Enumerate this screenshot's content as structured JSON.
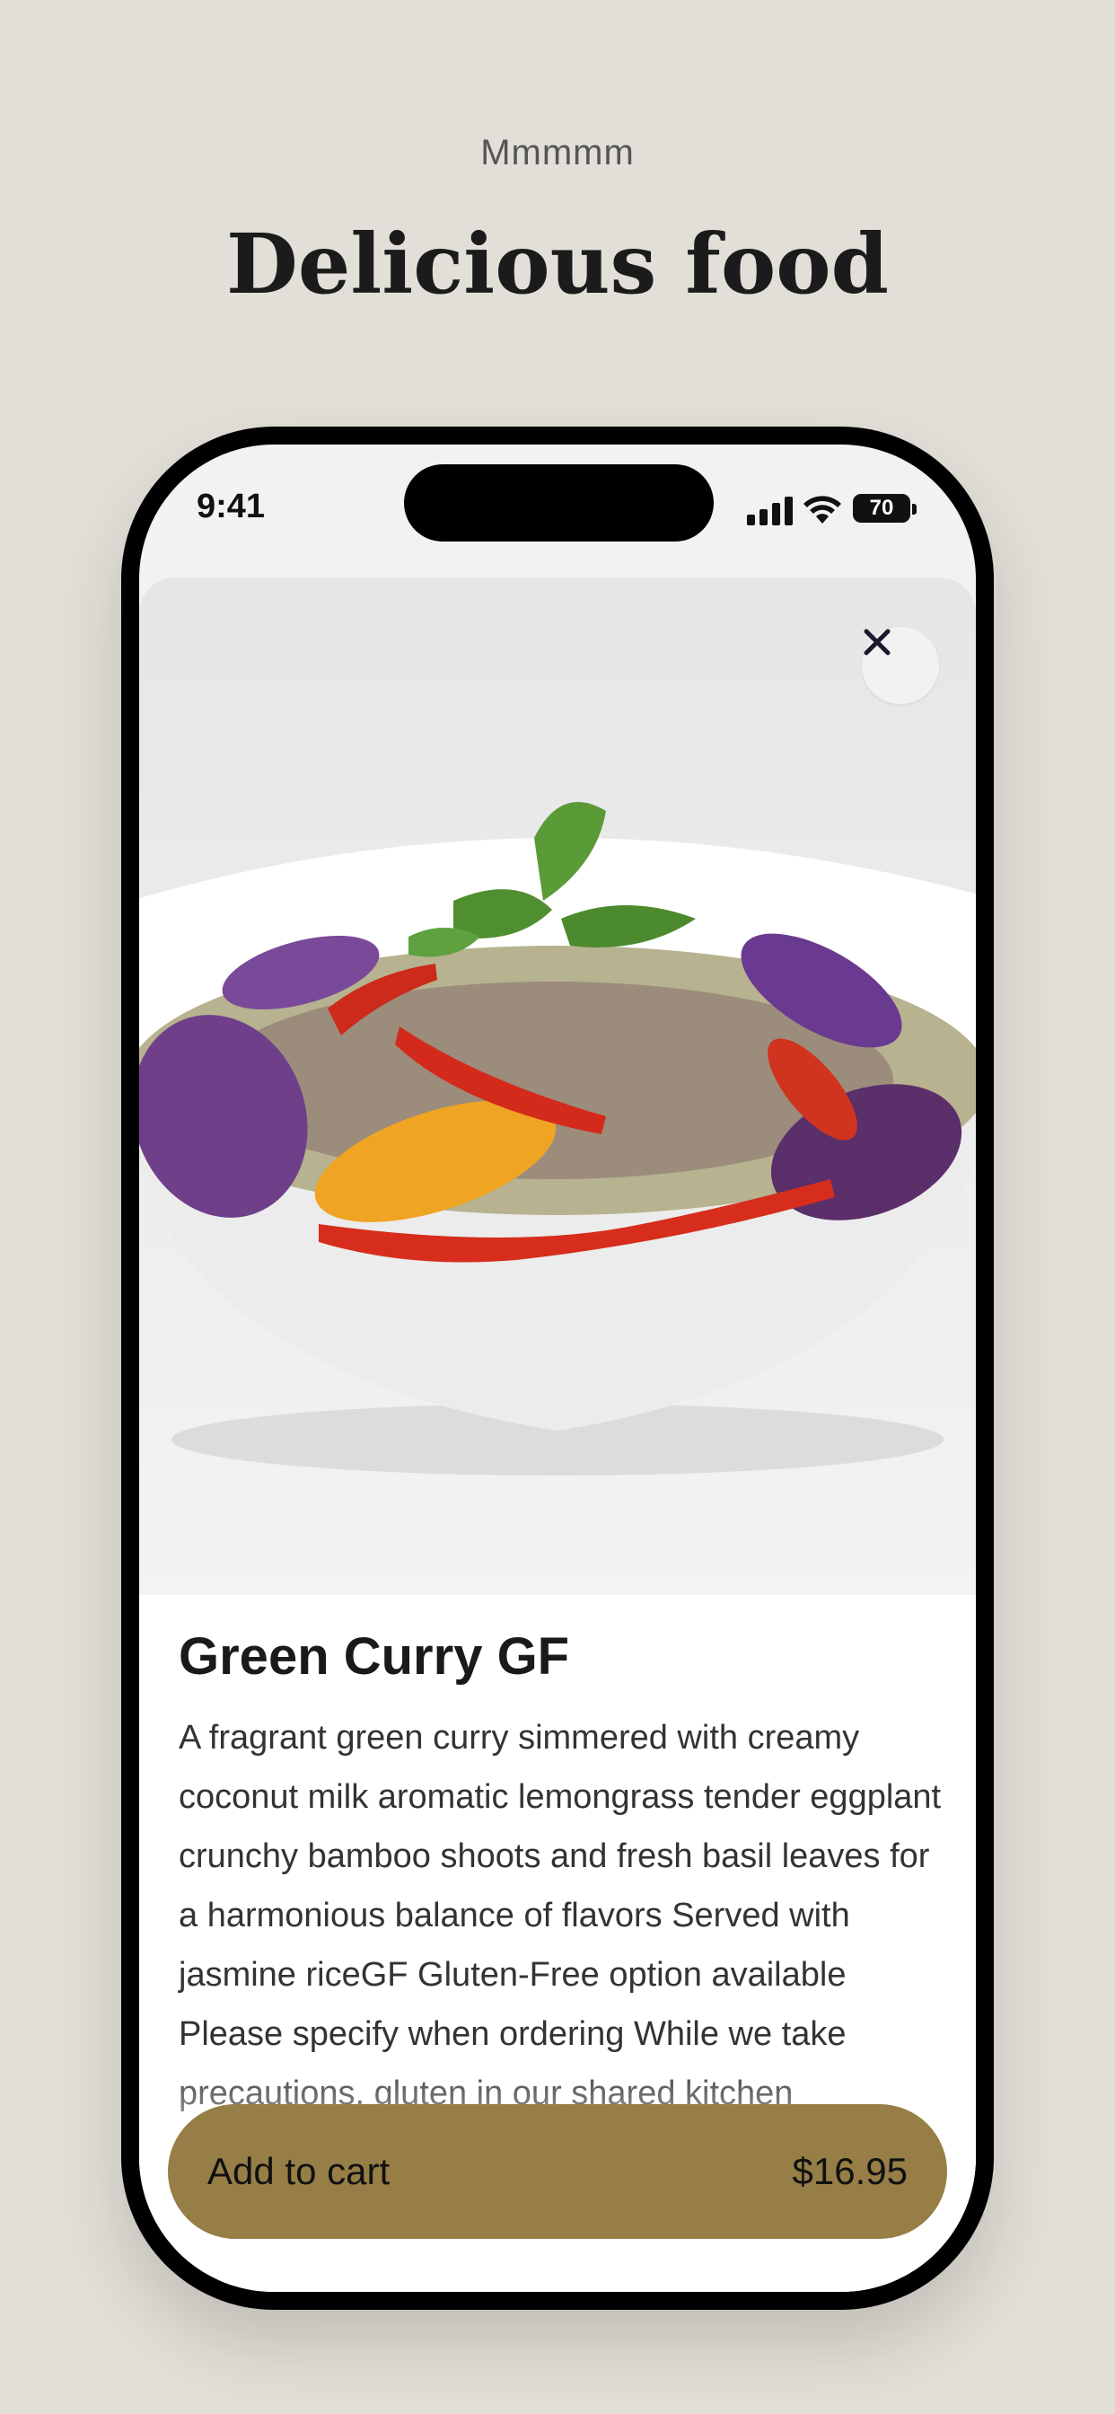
{
  "header": {
    "eyebrow": "Mmmmm",
    "title": "Delicious food"
  },
  "status_bar": {
    "time": "9:41",
    "battery": "70",
    "icons": [
      "signal-icon",
      "wifi-icon",
      "battery-icon"
    ]
  },
  "item": {
    "image": "green-curry-bowl",
    "title": "Green Curry GF",
    "description": "A fragrant green curry simmered with creamy coconut milk aromatic lemongrass tender eggplant crunchy bamboo shoots and fresh basil leaves for a harmonious balance of flavors Served with jasmine riceGF Gluten-Free option available Please specify when ordering While we take precautions, gluten in our shared kitchen"
  },
  "actions": {
    "close_icon": "close-icon",
    "add_to_cart": "Add to cart",
    "price": "$16.95"
  },
  "colors": {
    "background": "#e2dfd8",
    "button": "#967e46"
  }
}
